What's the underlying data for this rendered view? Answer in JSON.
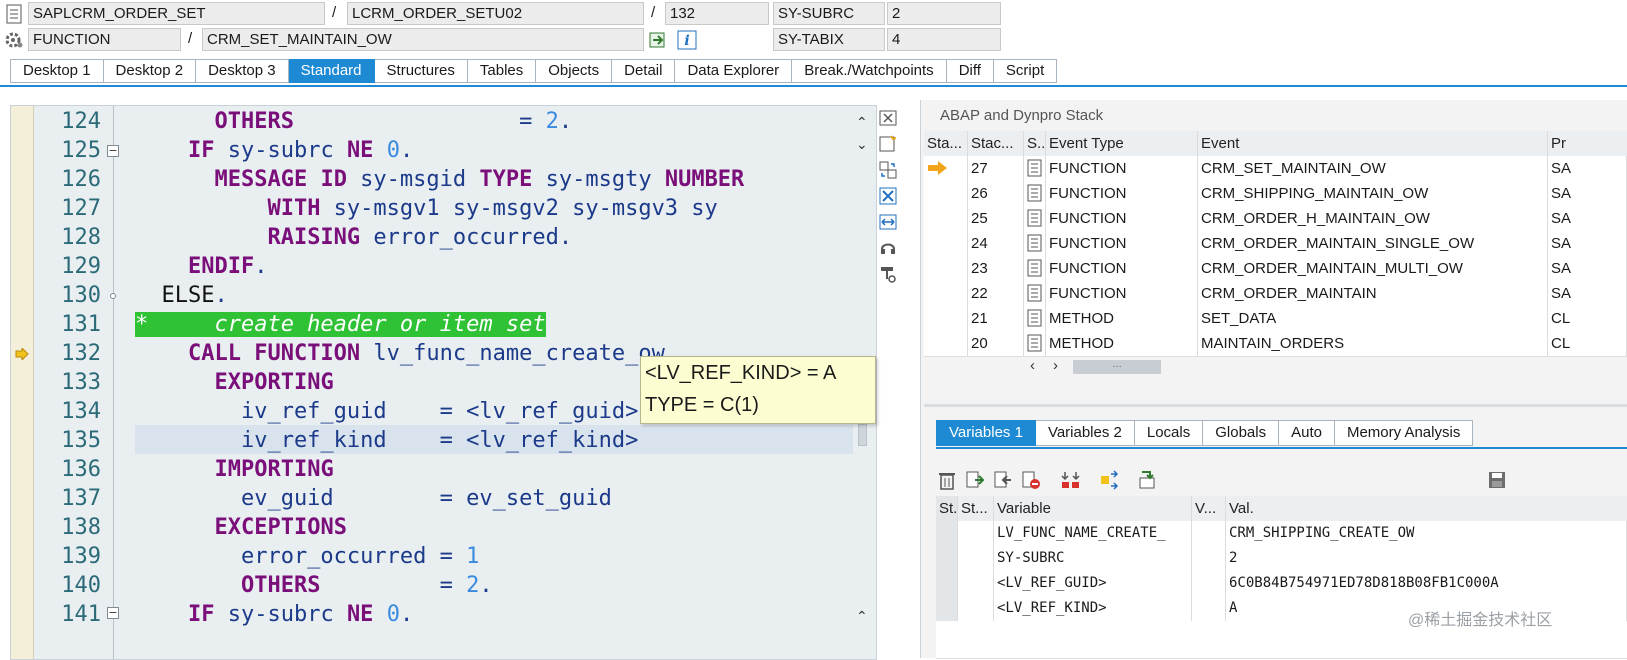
{
  "header": {
    "program": "SAPLCRM_ORDER_SET",
    "include": "LCRM_ORDER_SETU02",
    "line": "132",
    "event_type": "FUNCTION",
    "event": "CRM_SET_MAINTAIN_OW",
    "sysvar1_name": "SY-SUBRC",
    "sysvar1_value": "2",
    "sysvar2_name": "SY-TABIX",
    "sysvar2_value": "4",
    "slash": "/"
  },
  "tabs": [
    "Desktop 1",
    "Desktop 2",
    "Desktop 3",
    "Standard",
    "Structures",
    "Tables",
    "Objects",
    "Detail",
    "Data Explorer",
    "Break./Watchpoints",
    "Diff",
    "Script"
  ],
  "active_tab": "Standard",
  "editor": {
    "line_numbers": [
      "124",
      "125",
      "126",
      "127",
      "128",
      "129",
      "130",
      "131",
      "132",
      "133",
      "134",
      "135",
      "136",
      "137",
      "138",
      "139",
      "140",
      "141"
    ],
    "current_line": "132",
    "tooltip_line1": "<LV_REF_KIND> = A",
    "tooltip_line2": "TYPE  = C(1)"
  },
  "stack": {
    "title": "ABAP and Dynpro Stack",
    "columns": [
      "Sta...",
      "Stac...",
      "S..",
      "Event Type",
      "Event",
      "Pr"
    ],
    "rows": [
      {
        "level": "27",
        "type": "FUNCTION",
        "event": "CRM_SET_MAINTAIN_OW",
        "prog": "SA"
      },
      {
        "level": "26",
        "type": "FUNCTION",
        "event": "CRM_SHIPPING_MAINTAIN_OW",
        "prog": "SA"
      },
      {
        "level": "25",
        "type": "FUNCTION",
        "event": "CRM_ORDER_H_MAINTAIN_OW",
        "prog": "SA"
      },
      {
        "level": "24",
        "type": "FUNCTION",
        "event": "CRM_ORDER_MAINTAIN_SINGLE_OW",
        "prog": "SA"
      },
      {
        "level": "23",
        "type": "FUNCTION",
        "event": "CRM_ORDER_MAINTAIN_MULTI_OW",
        "prog": "SA"
      },
      {
        "level": "22",
        "type": "FUNCTION",
        "event": "CRM_ORDER_MAINTAIN",
        "prog": "SA"
      },
      {
        "level": "21",
        "type": "METHOD",
        "event": "SET_DATA",
        "prog": "CL"
      },
      {
        "level": "20",
        "type": "METHOD",
        "event": "MAINTAIN_ORDERS",
        "prog": "CL"
      }
    ],
    "scroll_grip": "…"
  },
  "var_tabs": [
    "Variables 1",
    "Variables 2",
    "Locals",
    "Globals",
    "Auto",
    "Memory Analysis"
  ],
  "active_var_tab": "Variables 1",
  "variables": {
    "columns": [
      "St...",
      "Variable",
      "V...",
      "Val."
    ],
    "rows": [
      {
        "name": "LV_FUNC_NAME_CREATE_",
        "value": "CRM_SHIPPING_CREATE_OW"
      },
      {
        "name": "SY-SUBRC",
        "value": "2"
      },
      {
        "name": "<LV_REF_GUID>",
        "value": "6C0B84B754971ED78D818B08FB1C000A"
      },
      {
        "name": "<LV_REF_KIND>",
        "value": "A"
      }
    ]
  },
  "watermark": "@稀土掘金技术社区",
  "colors": {
    "accent": "#1f8ad4",
    "comment_bg": "#2ec234",
    "tooltip_bg": "#fdfdd2"
  }
}
